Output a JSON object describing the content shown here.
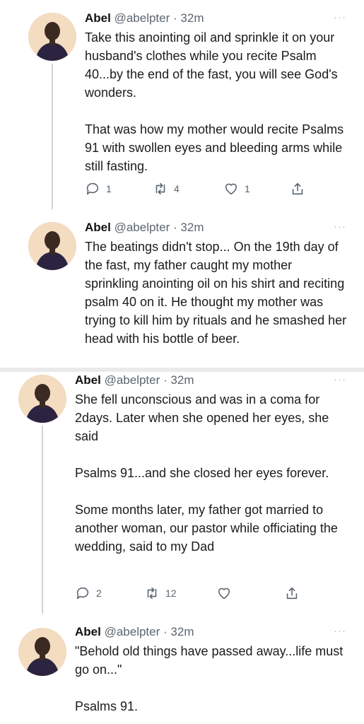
{
  "tweets": [
    {
      "name": "Abel",
      "handle": "@abelpter",
      "separator": "·",
      "time": "32m",
      "more": "···",
      "text": "Take this anointing oil and sprinkle it on your husband's clothes while you recite Psalm 40...by the end of the fast, you will see God's wonders.\n\nThat was how my mother would recite Psalms 91 with swollen eyes and bleeding arms while still fasting.",
      "replies": "1",
      "retweets": "4",
      "likes": "1"
    },
    {
      "name": "Abel",
      "handle": "@abelpter",
      "separator": "·",
      "time": "32m",
      "more": "···",
      "text": "The beatings didn't stop... On the 19th day of the fast, my father caught my mother sprinkling anointing oil on his shirt and reciting psalm 40 on it. He thought my mother was trying to kill him by rituals and he smashed her head with his bottle of beer."
    },
    {
      "name": "Abel",
      "handle": "@abelpter",
      "separator": "·",
      "time": "32m",
      "more": "···",
      "text": "She fell unconscious and was in a coma for 2days.  Later when she opened her eyes, she said\n\nPsalms 91...and she closed her eyes forever.\n\nSome months later, my father got married to another woman, our pastor while officiating the wedding, said to my Dad",
      "replies": "2",
      "retweets": "12",
      "likes": ""
    },
    {
      "name": "Abel",
      "handle": "@abelpter",
      "separator": "·",
      "time": "32m",
      "more": "···",
      "text": "\"Behold old things have passed away...life must go on...\"\n\nPsalms 91."
    }
  ],
  "icons": {
    "reply": "reply-icon",
    "retweet": "retweet-icon",
    "like": "heart-icon",
    "share": "share-icon"
  },
  "colors": {
    "text": "#1b1b1b",
    "muted": "#5b6670",
    "thread_line": "#cfd4d8"
  }
}
